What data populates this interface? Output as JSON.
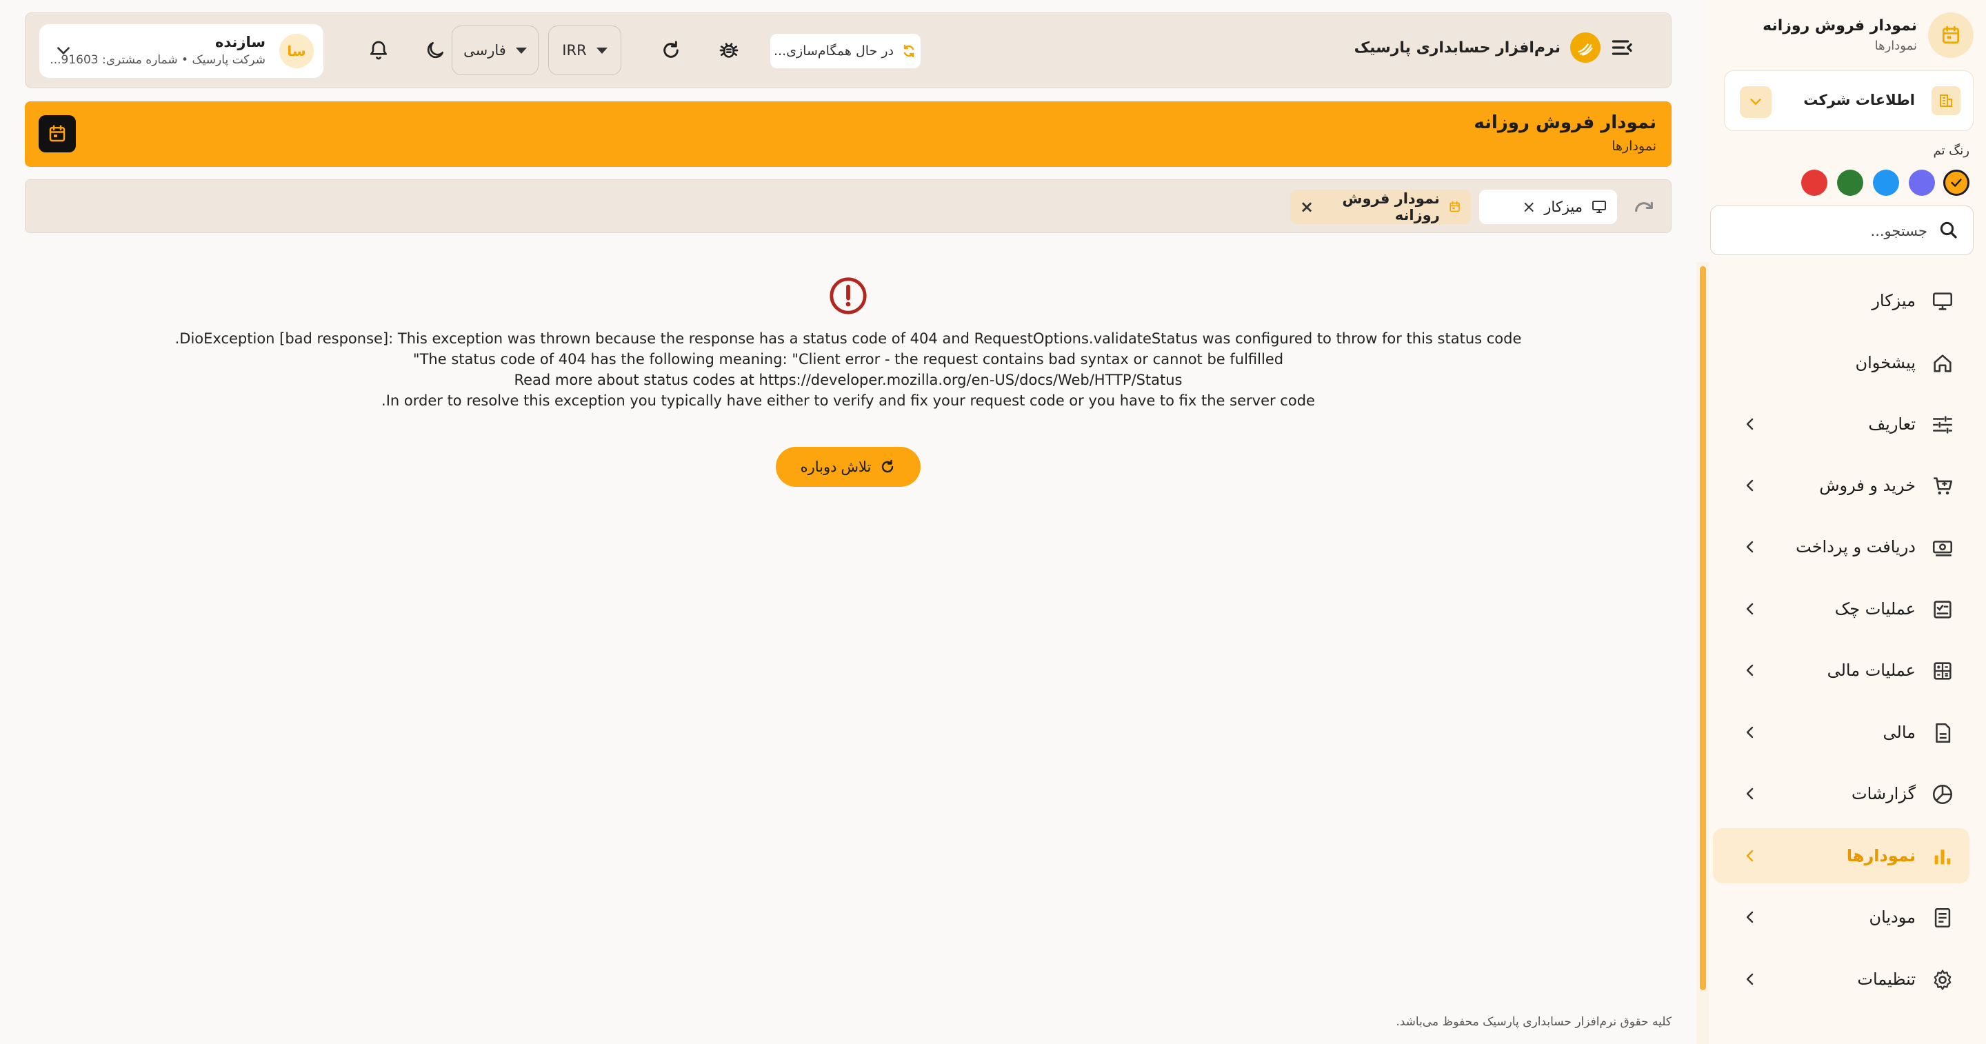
{
  "colors": {
    "accent": "#fda50f",
    "error": "#b3261e"
  },
  "header": {
    "brand_title": "نرم‌افزار حسابداری پارسیک",
    "sync_status": "در حال همگام‌سازی...",
    "currency": "IRR",
    "language": "فارسی",
    "user": {
      "avatar_initials": "سا",
      "name": "سازنده",
      "subtitle": "شرکت پارسیک • شماره مشتری: 91603..."
    },
    "icons": [
      "menu-icon",
      "sync-icon",
      "bug-icon",
      "refresh-icon",
      "moon-icon",
      "bell-icon",
      "chevron-down-icon"
    ]
  },
  "page": {
    "title": "نمودار فروش روزانه",
    "subtitle": "نمودارها"
  },
  "tabs": [
    {
      "label": "میزکار",
      "icon": "desktop-icon"
    },
    {
      "label": "نمودار فروش روزانه",
      "icon": "calendar-icon"
    }
  ],
  "error": {
    "lines": [
      "DioException [bad response]: This exception was thrown because the response has a status code of 404 and RequestOptions.validateStatus was configured to throw for this status code.",
      "The status code of 404 has the following meaning: \"Client error - the request contains bad syntax or cannot be fulfilled\"",
      "Read more about status codes at https://developer.mozilla.org/en-US/docs/Web/HTTP/Status",
      "In order to resolve this exception you typically have either to verify and fix your request code or you have to fix the server code."
    ],
    "retry_label": "تلاش دوباره"
  },
  "footer": {
    "copyright": "کلیه حقوق نرم‌افزار حسابداری پارسیک محفوظ می‌باشد."
  },
  "sidebar": {
    "title": "نمودار فروش روزانه",
    "subtitle": "نمودارها",
    "company_label": "اطلاعات شرکت",
    "theme_label": "رنگ تم",
    "theme_colors": [
      "#fda50f",
      "#6e6cf0",
      "#2196f3",
      "#2e7d32",
      "#e53935"
    ],
    "search_placeholder": "جستجو...",
    "items": [
      {
        "label": "میزکار",
        "icon": "desktop-icon",
        "has_children": false,
        "active": false
      },
      {
        "label": "پیشخوان",
        "icon": "home-icon",
        "has_children": false,
        "active": false
      },
      {
        "label": "تعاریف",
        "icon": "sliders-icon",
        "has_children": true,
        "active": false
      },
      {
        "label": "خرید و فروش",
        "icon": "cart-icon",
        "has_children": true,
        "active": false
      },
      {
        "label": "دریافت و پرداخت",
        "icon": "cash-icon",
        "has_children": true,
        "active": false
      },
      {
        "label": "عملیات چک",
        "icon": "check-icon",
        "has_children": true,
        "active": false
      },
      {
        "label": "عملیات مالی",
        "icon": "calculator-icon",
        "has_children": true,
        "active": false
      },
      {
        "label": "مالی",
        "icon": "document-icon",
        "has_children": true,
        "active": false
      },
      {
        "label": "گزارشات",
        "icon": "pie-chart-icon",
        "has_children": true,
        "active": false
      },
      {
        "label": "نمودارها",
        "icon": "bar-chart-icon",
        "has_children": true,
        "active": true
      },
      {
        "label": "مودیان",
        "icon": "receipt-icon",
        "has_children": true,
        "active": false
      },
      {
        "label": "تنظیمات",
        "icon": "gear-icon",
        "has_children": true,
        "active": false
      }
    ]
  }
}
